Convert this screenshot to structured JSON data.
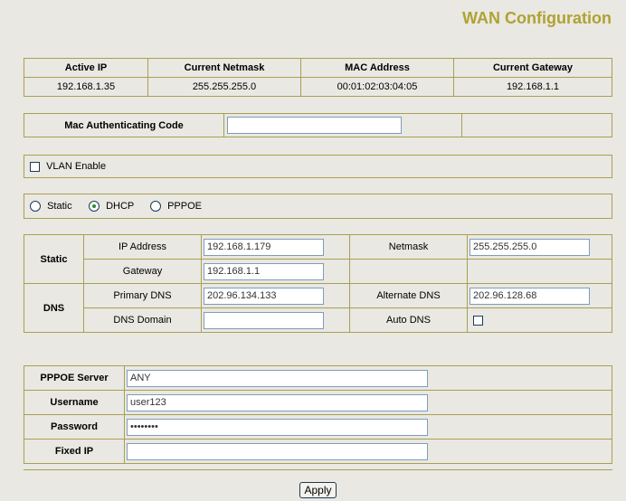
{
  "page": {
    "title": "WAN Configuration"
  },
  "status": {
    "headers": [
      "Active IP",
      "Current Netmask",
      "MAC Address",
      "Current Gateway"
    ],
    "values": [
      "192.168.1.35",
      "255.255.255.0",
      "00:01:02:03:04:05",
      "192.168.1.1"
    ]
  },
  "mac_auth": {
    "label": "Mac Authenticating Code",
    "value": ""
  },
  "vlan": {
    "label": "VLAN Enable",
    "checked": false
  },
  "mode": {
    "options": [
      "Static",
      "DHCP",
      "PPPOE"
    ],
    "selected": "DHCP"
  },
  "static": {
    "section_label": "Static",
    "ip_label": "IP Address",
    "ip_value": "192.168.1.179",
    "netmask_label": "Netmask",
    "netmask_value": "255.255.255.0",
    "gateway_label": "Gateway",
    "gateway_value": "192.168.1.1"
  },
  "dns": {
    "section_label": "DNS",
    "primary_label": "Primary DNS",
    "primary_value": "202.96.134.133",
    "alternate_label": "Alternate DNS",
    "alternate_value": "202.96.128.68",
    "domain_label": "DNS Domain",
    "domain_value": "",
    "auto_label": "Auto DNS",
    "auto_checked": false
  },
  "pppoe": {
    "server_label": "PPPOE Server",
    "server_value": "ANY",
    "username_label": "Username",
    "username_value": "user123",
    "password_label": "Password",
    "password_value": "password",
    "fixed_ip_label": "Fixed IP",
    "fixed_ip_value": ""
  },
  "actions": {
    "apply_label": "Apply"
  },
  "colors": {
    "title": "#b0a233",
    "border": "#a8a054",
    "background": "#e9e8e2"
  }
}
